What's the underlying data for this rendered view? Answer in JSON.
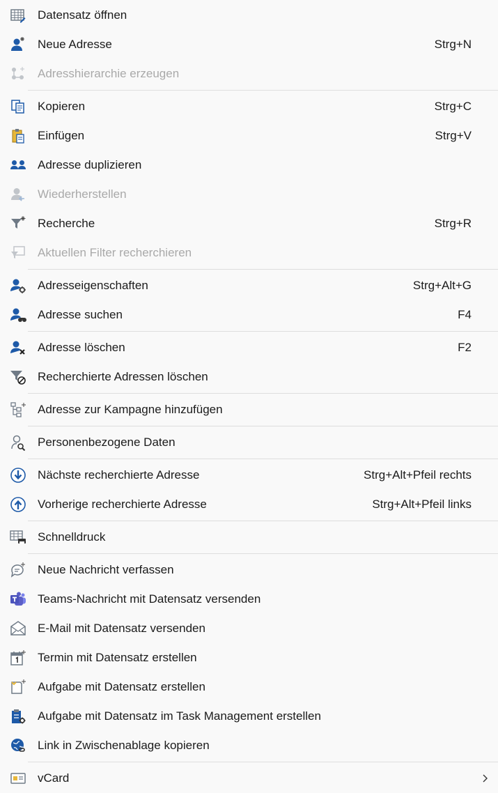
{
  "menu": {
    "items": [
      {
        "label": "Datensatz öffnen",
        "shortcut": ""
      },
      {
        "label": "Neue Adresse",
        "shortcut": "Strg+N"
      },
      {
        "label": "Adresshierarchie erzeugen",
        "shortcut": ""
      },
      {
        "label": "Kopieren",
        "shortcut": "Strg+C"
      },
      {
        "label": "Einfügen",
        "shortcut": "Strg+V"
      },
      {
        "label": "Adresse duplizieren",
        "shortcut": ""
      },
      {
        "label": "Wiederherstellen",
        "shortcut": ""
      },
      {
        "label": "Recherche",
        "shortcut": "Strg+R"
      },
      {
        "label": "Aktuellen Filter recherchieren",
        "shortcut": ""
      },
      {
        "label": "Adresseigenschaften",
        "shortcut": "Strg+Alt+G"
      },
      {
        "label": "Adresse suchen",
        "shortcut": "F4"
      },
      {
        "label": "Adresse löschen",
        "shortcut": "F2"
      },
      {
        "label": "Recherchierte Adressen löschen",
        "shortcut": ""
      },
      {
        "label": "Adresse zur Kampagne hinzufügen",
        "shortcut": ""
      },
      {
        "label": "Personenbezogene Daten",
        "shortcut": ""
      },
      {
        "label": "Nächste recherchierte Adresse",
        "shortcut": "Strg+Alt+Pfeil rechts"
      },
      {
        "label": "Vorherige recherchierte Adresse",
        "shortcut": "Strg+Alt+Pfeil links"
      },
      {
        "label": "Schnelldruck",
        "shortcut": ""
      },
      {
        "label": "Neue Nachricht verfassen",
        "shortcut": ""
      },
      {
        "label": "Teams-Nachricht mit Datensatz versenden",
        "shortcut": ""
      },
      {
        "label": "E-Mail mit Datensatz versenden",
        "shortcut": ""
      },
      {
        "label": "Termin mit Datensatz erstellen",
        "shortcut": ""
      },
      {
        "label": "Aufgabe mit Datensatz erstellen",
        "shortcut": ""
      },
      {
        "label": "Aufgabe mit Datensatz im Task Management erstellen",
        "shortcut": ""
      },
      {
        "label": "Link in Zwischenablage kopieren",
        "shortcut": ""
      },
      {
        "label": "vCard",
        "shortcut": ""
      }
    ]
  },
  "icons": {
    "open_record": "table-grid-icon",
    "new_address": "person-add-icon",
    "hierarchy": "hierarchy-icon",
    "copy": "copy-icon",
    "paste": "paste-icon",
    "duplicate": "people-duplicate-icon",
    "restore": "person-restore-icon",
    "search": "filter-sparkle-icon",
    "current_filter": "filter-screen-icon",
    "properties": "person-gear-icon",
    "find": "person-binoculars-icon",
    "delete": "person-delete-icon",
    "delete_researched": "filter-delete-icon",
    "campaign": "campaign-tree-icon",
    "personal_data": "person-lock-icon",
    "next": "circle-arrow-down-icon",
    "previous": "circle-arrow-up-icon",
    "quick_print": "printer-grid-icon",
    "new_message": "chat-add-icon",
    "teams": "teams-icon",
    "email": "mail-icon",
    "appointment": "calendar-icon",
    "task": "task-note-icon",
    "task_management": "task-clipboard-icon",
    "link": "globe-link-icon",
    "vcard": "vcard-icon",
    "submenu": "chevron-right-icon"
  },
  "colors": {
    "blue": "#1e5aa8",
    "gray": "#6f7a86",
    "disabled_text": "#a9a9a9",
    "separator": "#dedede",
    "teams": "#5b5fc7",
    "yellow": "#e7b73a"
  }
}
